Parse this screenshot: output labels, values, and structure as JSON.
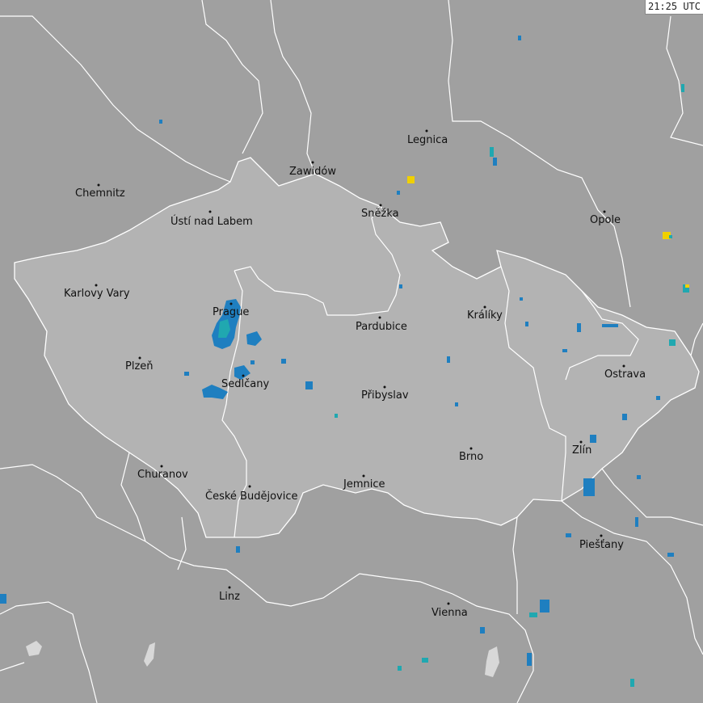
{
  "timestamp": "21:25 UTC",
  "colors": {
    "background": "#a0a0a0",
    "czech_fill": "#b3b3b3",
    "border": "#ffffff",
    "city_text": "#111111",
    "strike_old": "#1f7fc0",
    "strike_mid": "#20a8b0",
    "strike_new": "#f0d000"
  },
  "cities": [
    {
      "name": "Chemnitz"
    },
    {
      "name": "Zawidów"
    },
    {
      "name": "Legnica"
    },
    {
      "name": "Sněžka"
    },
    {
      "name": "Ústí nad Labem"
    },
    {
      "name": "Opole"
    },
    {
      "name": "Karlovy Vary"
    },
    {
      "name": "Prague"
    },
    {
      "name": "Králíky"
    },
    {
      "name": "Pardubice"
    },
    {
      "name": "Plzeň"
    },
    {
      "name": "Ostrava"
    },
    {
      "name": "Sedlčany"
    },
    {
      "name": "Přibyslav"
    },
    {
      "name": "Zlín"
    },
    {
      "name": "Brno"
    },
    {
      "name": "Churanov"
    },
    {
      "name": "Jemnice"
    },
    {
      "name": "České Budějovice"
    },
    {
      "name": "Piešťany"
    },
    {
      "name": "Linz"
    },
    {
      "name": "Vienna"
    }
  ]
}
